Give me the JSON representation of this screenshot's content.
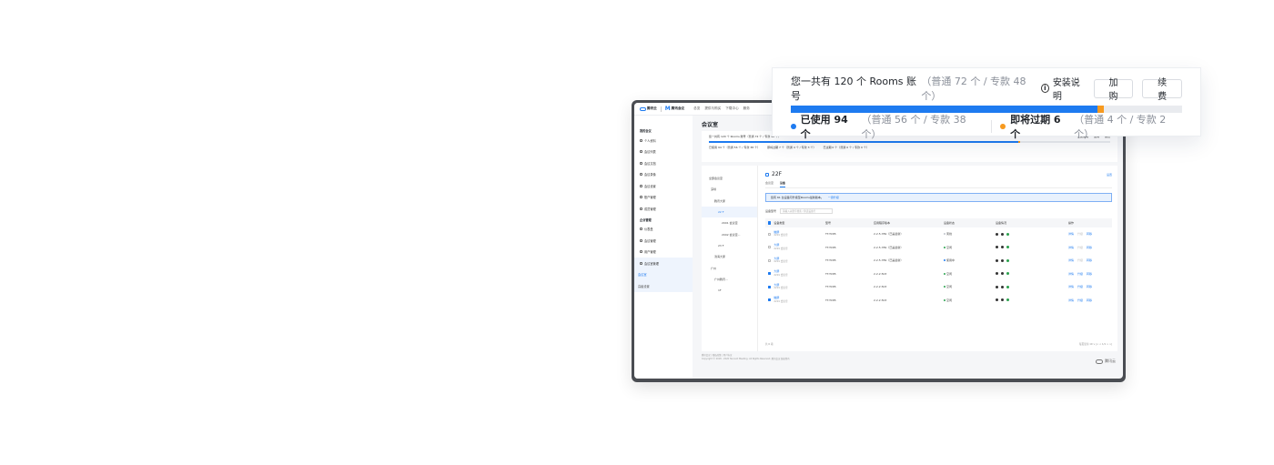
{
  "callout": {
    "headline": "您一共有 120 个 Rooms 账号",
    "headline_detail": "（普通 72 个 / 专款 48 个）",
    "install_guide": "安装说明",
    "buy_button": "加购",
    "renew_button": "续费",
    "usage": {
      "used": 94,
      "total": 120,
      "expiring": 6
    },
    "used_label": "已使用 94 个",
    "used_detail": "（普通 56 个 / 专款 38 个）",
    "expiring_label": "即将过期 6 个",
    "expiring_detail": "（普通 4 个 / 专款 2 个）",
    "colors": {
      "used": "#1e7bf0",
      "expiring": "#f79a1f",
      "track": "#e9ebef"
    }
  },
  "app": {
    "brand_tencent_cloud": "腾讯云",
    "brand_meeting": "腾讯会议",
    "nav": [
      "总览",
      "提供与购买",
      "下载中心",
      "服务"
    ],
    "sidebar": {
      "group1": "我的会议",
      "items1": [
        "个人资料",
        "会议列表",
        "会议文档",
        "会议录像",
        "会议设置",
        "账户管理",
        "成员管理"
      ],
      "group2": "企业管理",
      "items2": [
        "仪表盘",
        "会议管理",
        "用户管理"
      ],
      "room_mgmt": "会议室管理",
      "sub_items": [
        "会议室",
        "高级设置"
      ]
    },
    "page_title": "会议室",
    "summary_line": "您一共有 120 个 Rooms 账号（普通 72 个 / 专款 48 个）",
    "summary_actions": [
      "安装说明",
      "加购",
      "续费"
    ],
    "mini_used": "已使用 94 个（普通 56 个 / 专款 38 个）",
    "mini_expiring": "即将过期 7 个（普通 4 个 / 专款 3 个）",
    "mini_expired": "已过期 0 个（普通 0 个 / 专款 0 个）",
    "tree": [
      "全部会议室",
      "深圳",
      "腾讯大厦",
      "22 F",
      "2001 会议室",
      "2002 会议室...",
      "23 F",
      "滨海大厦",
      "广州",
      "广州腾讯…",
      "1F"
    ],
    "floor": "22F",
    "settings_link": "设置",
    "tabs": [
      "会议室",
      "设备"
    ],
    "notice": "您有 61 台设备可升级至Rooms最新版本。",
    "notice_link": "一键升级",
    "filter_label": "设备型号",
    "search_placeholder": "请输入关键字搜索 / 筛选设备号",
    "table": {
      "headers": [
        "设备类型",
        "型号",
        "应用程序版本",
        "设备状态",
        "设备情况",
        "操作"
      ],
      "rows": [
        {
          "name": "触屏",
          "sub": "2201 会议室",
          "model": "TT-TC85",
          "version": "2.2.5.789（已是最新）",
          "status": "离线",
          "status_color": "#c0c4cc",
          "checked": false,
          "ops": [
            "详情",
            "升级",
            "转移"
          ],
          "upgrade_enabled": false
        },
        {
          "name": "大屏",
          "sub": "2201 会议室",
          "model": "TT-TC85",
          "version": "2.2.5.789（已是最新）",
          "status": "空闲",
          "status_color": "#2aa14d",
          "checked": false,
          "ops": [
            "详情",
            "升级",
            "转移"
          ],
          "upgrade_enabled": false
        },
        {
          "name": "大屏",
          "sub": "2201 会议室",
          "model": "TT-TC85",
          "version": "2.2.5.789（已是最新）",
          "status": "使用中",
          "status_color": "#1e7bf0",
          "checked": false,
          "ops": [
            "详情",
            "升级",
            "转移"
          ],
          "upgrade_enabled": false
        },
        {
          "name": "大屏",
          "sub": "2201 会议室",
          "model": "TT-TC85",
          "version": "2.2.2.503",
          "status": "空闲",
          "status_color": "#2aa14d",
          "checked": true,
          "ops": [
            "详情",
            "升级",
            "转移"
          ],
          "upgrade_enabled": true
        },
        {
          "name": "大屏",
          "sub": "2201 会议室",
          "model": "TT-TC85",
          "version": "2.2.2.503",
          "status": "空闲",
          "status_color": "#2aa14d",
          "checked": true,
          "ops": [
            "详情",
            "升级",
            "转移"
          ],
          "upgrade_enabled": true
        },
        {
          "name": "触屏",
          "sub": "2201 会议室",
          "model": "TT-TC85",
          "version": "2.2.2.503",
          "status": "空闲",
          "status_color": "#2aa14d",
          "checked": true,
          "ops": [
            "详情",
            "升级",
            "转移"
          ],
          "upgrade_enabled": true
        }
      ]
    },
    "pager_total": "共 6 项",
    "pager_right": "每页显示 10 ∨    |<   <    1/1    >   >|",
    "footer_links": "腾讯会议 | 隐私政策 | 用户协议",
    "footer_copyright": "Copyright © 2018 - 2020 Tencent Meeting. All Rights Reserved. 腾讯会议 版权所有",
    "footer_brand": "腾讯云"
  }
}
